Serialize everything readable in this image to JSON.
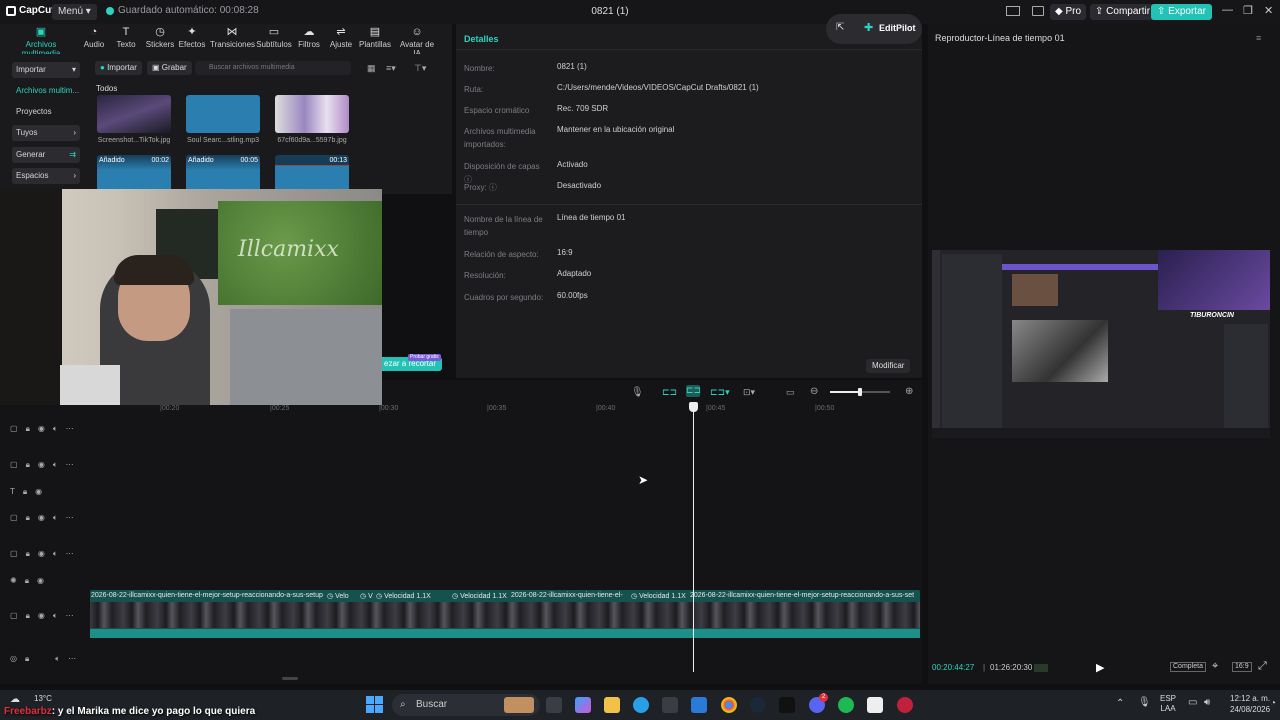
{
  "titlebar": {
    "app_name": "CapCut",
    "menu_label": "Menú",
    "autosave": "Guardado automático: 00:08:28",
    "project_title": "0821 (1)",
    "pro_label": "Pro",
    "share_label": "Compartir",
    "export_label": "Exportar"
  },
  "toolbar": {
    "items": [
      {
        "label": "Archivos multimedia",
        "icon": "media-icon",
        "active": true
      },
      {
        "label": "Audio",
        "icon": "audio-icon"
      },
      {
        "label": "Texto",
        "icon": "text-icon"
      },
      {
        "label": "Stickers",
        "icon": "sticker-icon"
      },
      {
        "label": "Efectos",
        "icon": "effects-icon"
      },
      {
        "label": "Transiciones",
        "icon": "transitions-icon"
      },
      {
        "label": "Subtítulos",
        "icon": "subtitles-icon"
      },
      {
        "label": "Filtros",
        "icon": "filters-icon"
      },
      {
        "label": "Ajuste",
        "icon": "adjust-icon"
      },
      {
        "label": "Plantillas",
        "icon": "templates-icon"
      },
      {
        "label": "Avatar de IA",
        "icon": "avatar-icon"
      }
    ]
  },
  "sidebar": {
    "items": [
      {
        "label": "Importar",
        "selected": true
      },
      {
        "label": "Archivos multim...",
        "active": true
      },
      {
        "label": "Proyectos secun..."
      },
      {
        "label": "Tuyos"
      },
      {
        "label": "Generar"
      },
      {
        "label": "Espacios"
      }
    ]
  },
  "media": {
    "import_label": "Importar",
    "record_label": "Grabar",
    "search_placeholder": "Buscar archivos multimedia",
    "section_label": "Todos",
    "items": [
      {
        "caption": "Screenshot...TikTok.jpg"
      },
      {
        "caption": "Soul Searc...stling.mp3"
      },
      {
        "caption": "67cf60d9a...5597b.jpg"
      },
      {
        "badge": "Añadido",
        "duration": "00:02"
      },
      {
        "badge": "Añadido",
        "duration": "00:05"
      },
      {
        "duration": "00:13"
      }
    ]
  },
  "details": {
    "header": "Detalles",
    "editpilot_label": "EditPilot",
    "rows": [
      {
        "label": "Nombre:",
        "value": "0821 (1)"
      },
      {
        "label": "Ruta:",
        "value": "C:/Users/mende/Videos/VIDEOS/CapCut Drafts/0821 (1)"
      },
      {
        "label": "Espacio cromático",
        "value": "Rec. 709 SDR"
      },
      {
        "label": "Archivos multimedia importados:",
        "value": "Mantener en la ubicación original"
      },
      {
        "label": "Disposición de capas",
        "value": "Activado"
      },
      {
        "label": "Proxy:",
        "value": "Desactivado"
      },
      {
        "label": "Nombre de la línea de tiempo",
        "value": "Línea de tiempo 01"
      },
      {
        "label": "Relación de aspecto:",
        "value": "16:9"
      },
      {
        "label": "Resolución:",
        "value": "Adaptado"
      },
      {
        "label": "Cuadros por segundo:",
        "value": "60.00fps"
      }
    ],
    "modify_label": "Modificar",
    "trim_label": "ezar a recortar",
    "trial_badge": "Probar gratis"
  },
  "player": {
    "title": "Reproductor-Línea de tiempo 01",
    "current_time": "00:20:44:27",
    "total_time": "01:26:20:30",
    "mode_label": "Completa",
    "ratio_label": "16:9",
    "overlay_name": "TIBURONCIN"
  },
  "timeline": {
    "ticks": [
      "|00:20",
      "|00:25",
      "|00:30",
      "|00:35",
      "|00:40",
      "|00:45",
      "|00:50"
    ],
    "clips": [
      "2026-08-22-illcamixx-quien-tiene-el-mejor-setup-reaccionando-a-sus-setup",
      "Velo",
      "V",
      "Velocidad 1.1X",
      "Velocidad 1.1X",
      "2026-08-22-illcamixx-quien-tiene-el-",
      "Velocidad 1.1X",
      "2026-08-22-illcamixx-quien-tiene-el-mejor-setup-reaccionando-a-sus-set"
    ]
  },
  "taskbar": {
    "temperature": "13°C",
    "search_placeholder": "Buscar",
    "lang_top": "ESP",
    "lang_bottom": "LAA",
    "time": "12:12 a. m.",
    "date": "24/08/2026",
    "discord_badge": "2"
  },
  "caption": {
    "nick": "Freebarbz",
    "text": ": y el Marika me dice yo pago lo que quiera"
  },
  "colors": {
    "accent": "#2bd4c0",
    "export": "#22c3b5",
    "clip": "#1f8f8a"
  }
}
